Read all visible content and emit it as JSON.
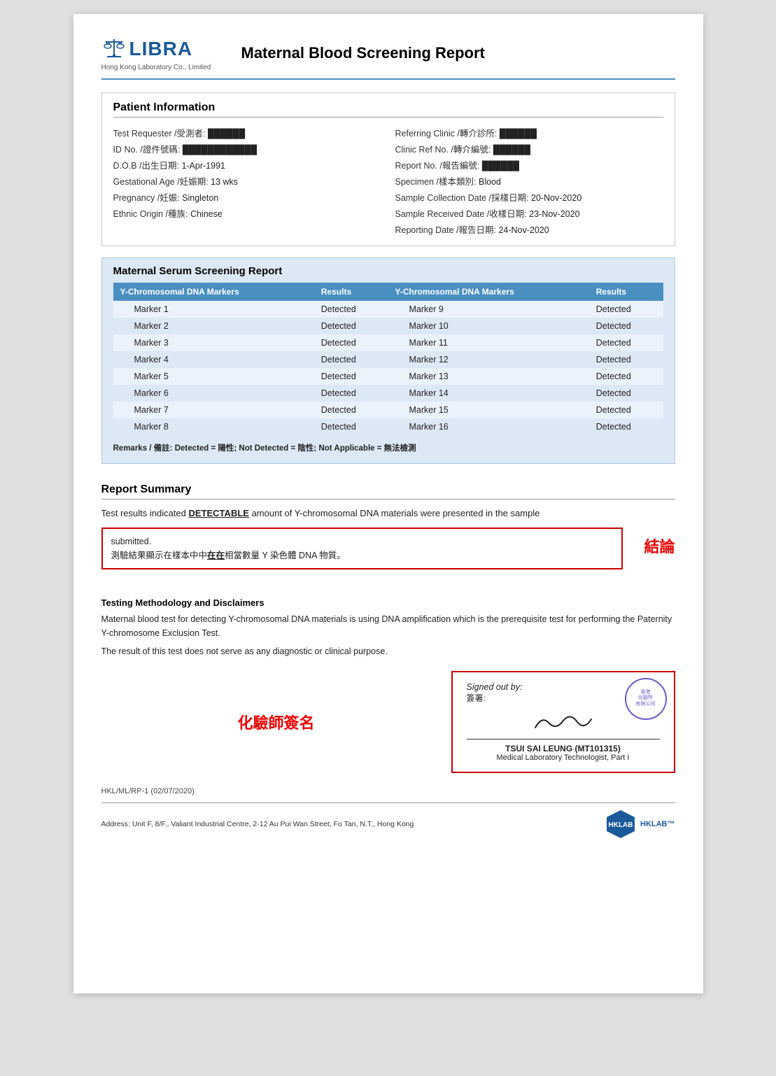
{
  "header": {
    "logo_brand": "LIBRA",
    "logo_subtitle": "Hong Kong Laboratory Co., Limited",
    "report_title": "Maternal Blood Screening Report"
  },
  "patient_info": {
    "section_title": "Patient Information",
    "left_fields": [
      {
        "label": "Test Requester /受測者:",
        "value": "████████"
      },
      {
        "label": "ID No. /證件號碼:",
        "value": "████████████"
      },
      {
        "label": "D.O.B /出生日期:",
        "value": "1-Apr-1991"
      },
      {
        "label": "Gestational Age /妊娠期:",
        "value": "13 wks"
      },
      {
        "label": "Pregnancy /妊娠:",
        "value": "Singleton"
      },
      {
        "label": "Ethnic Origin /種族:",
        "value": "Chinese"
      }
    ],
    "right_fields": [
      {
        "label": "Referring Clinic /轉介診所:",
        "value": "████████"
      },
      {
        "label": "Clinic Ref No. /轉介編號:",
        "value": "████████"
      },
      {
        "label": "Report No. /報告編號:",
        "value": "████████"
      },
      {
        "label": "Specimen /樣本類別:",
        "value": "Blood"
      },
      {
        "label": "Sample Collection Date /採樣日期:",
        "value": "20-Nov-2020"
      },
      {
        "label": "Sample Received Date /收樣日期:",
        "value": "23-Nov-2020"
      },
      {
        "label": "Reporting Date /報告日期:",
        "value": "24-Nov-2020"
      }
    ]
  },
  "serum_section": {
    "title": "Maternal Serum Screening Report",
    "col1_header": "Y-Chromosomal DNA Markers",
    "col2_header": "Results",
    "col3_header": "Y-Chromosomal DNA Markers",
    "col4_header": "Results",
    "markers_left": [
      {
        "marker": "Marker 1",
        "result": "Detected"
      },
      {
        "marker": "Marker 2",
        "result": "Detected"
      },
      {
        "marker": "Marker 3",
        "result": "Detected"
      },
      {
        "marker": "Marker 4",
        "result": "Detected"
      },
      {
        "marker": "Marker 5",
        "result": "Detected"
      },
      {
        "marker": "Marker 6",
        "result": "Detected"
      },
      {
        "marker": "Marker 7",
        "result": "Detected"
      },
      {
        "marker": "Marker 8",
        "result": "Detected"
      }
    ],
    "markers_right": [
      {
        "marker": "Marker 9",
        "result": "Detected"
      },
      {
        "marker": "Marker 10",
        "result": "Detected"
      },
      {
        "marker": "Marker 11",
        "result": "Detected"
      },
      {
        "marker": "Marker 12",
        "result": "Detected"
      },
      {
        "marker": "Marker 13",
        "result": "Detected"
      },
      {
        "marker": "Marker 14",
        "result": "Detected"
      },
      {
        "marker": "Marker 15",
        "result": "Detected"
      },
      {
        "marker": "Marker 16",
        "result": "Detected"
      }
    ],
    "remarks": "Remarks / 備註: Detected = 陽性; Not Detected = 陰性; Not Applicable = 無法檢測"
  },
  "report_summary": {
    "section_title": "Report Summary",
    "summary_text_1": "Test results indicated ",
    "detectable": "DETECTABLE",
    "summary_text_2": " amount of Y-chromosomal DNA materials were presented in the sample",
    "submitted_line": "submitted.",
    "chinese_result": "測驗結果顯示在樣本中在在相當數量 Y 染色體 DNA 物質。",
    "conclusion_label": "結論"
  },
  "methodology": {
    "title": "Testing Methodology and Disclaimers",
    "text1": "Maternal blood test for detecting Y-chromosomal DNA materials is using DNA amplification which is the prerequisite test for performing the Paternity Y-chromosome Exclusion Test.",
    "text2": "The result of this test does not serve as any diagnostic or clinical purpose."
  },
  "signature": {
    "chemist_label": "化驗師簽名",
    "signed_out_by": "Signed out by:",
    "signed_out_cn": "簽署:",
    "stamp_text": "香港\n化驗所\n有限公司",
    "signatory_name": "TSUI SAI LEUNG (MT101315)",
    "signatory_title": "Medical Laboratory Technologist, Part I"
  },
  "footer": {
    "doc_ref": "HKL/ML/RP-1 (02/07/2020)",
    "address": "Address: Unit F, 8/F., Valiant Industrial Centre, 2-12 Au Pui Wan Street, Fo Tan, N.T., Hong Kong",
    "hklab": "HKLAB™"
  }
}
